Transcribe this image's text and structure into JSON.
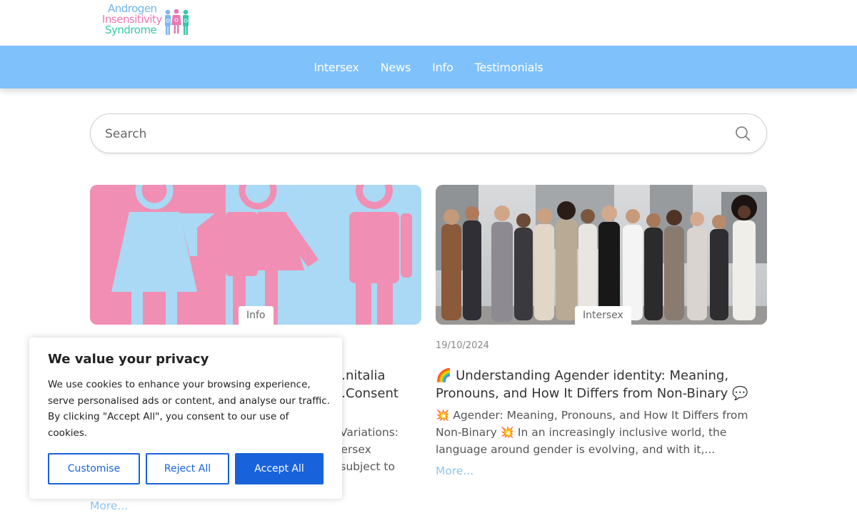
{
  "logo": {
    "line1": "Androgen",
    "line2": "Insensitivity",
    "line3": "Syndrome",
    "colors": [
      "#6fb4e8",
      "#e978b3",
      "#35c9a8"
    ]
  },
  "nav": {
    "items": [
      {
        "label": "Intersex"
      },
      {
        "label": "News"
      },
      {
        "label": "Info"
      },
      {
        "label": "Testimonials"
      }
    ],
    "background": "#7fc1fb"
  },
  "search": {
    "placeholder": "Search"
  },
  "posts": [
    {
      "category": "Info",
      "date": "",
      "title_visible": "…nitalia\n…Consent",
      "excerpt_visible": "…a Variations:\n…ntersex\n…d subject to\n….",
      "more_label": "More..."
    },
    {
      "category": "Intersex",
      "date": "19/10/2024",
      "title": "🌈 Understanding Agender identity: Meaning, Pronouns, and How It Differs from Non-Binary 💬",
      "excerpt": "💥 Agender: Meaning, Pronouns, and How It Differs from Non-Binary 💥 In an increasingly inclusive world, the language around gender is evolving, and with it,...",
      "more_label": "More..."
    }
  ],
  "cookie_banner": {
    "title": "We value your privacy",
    "text": "We use cookies to enhance your browsing experience, serve personalised ads or content, and analyse our traffic. By clicking \"Accept All\", you consent to our use of cookies.",
    "buttons": {
      "customise": "Customise",
      "reject": "Reject All",
      "accept": "Accept All"
    },
    "accent": "#1863dc"
  }
}
